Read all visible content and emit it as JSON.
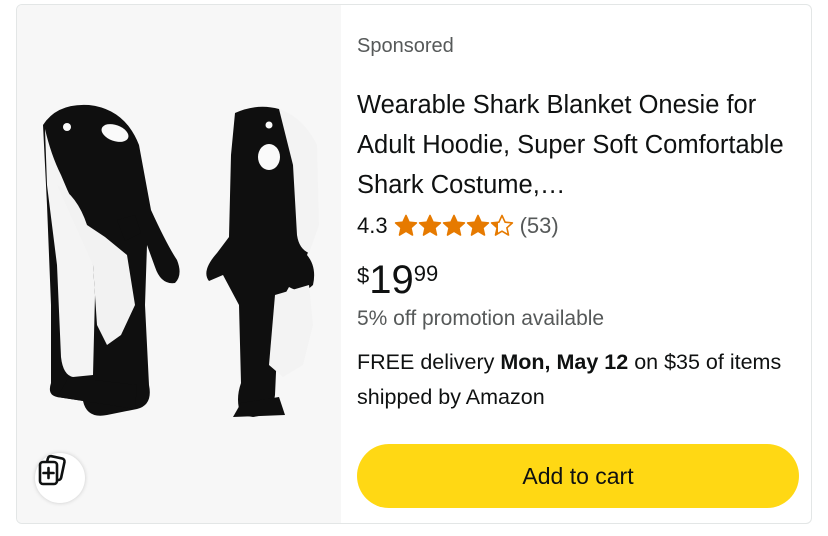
{
  "listing": {
    "sponsored_label": "Sponsored",
    "title": "Wearable Shark Blanket Onesie for Adult Hoodie, Super Soft Comfortable Shark Costume,…",
    "rating_value": "4.3",
    "rating_stars": 4.3,
    "review_count": "(53)",
    "price": {
      "symbol": "$",
      "whole": "19",
      "fraction": "99"
    },
    "promotion": "5% off promotion available",
    "delivery": {
      "prefix": "FREE delivery ",
      "date": "Mon, May 12",
      "suffix": " on $35 of items shipped by Amazon"
    },
    "add_to_cart_label": "Add to cart"
  },
  "colors": {
    "star": "#e67a00",
    "button": "#ffd814",
    "secondary_text": "#565959"
  },
  "icons": {
    "compare": "compare-cards-plus-icon",
    "star": "star-icon"
  }
}
